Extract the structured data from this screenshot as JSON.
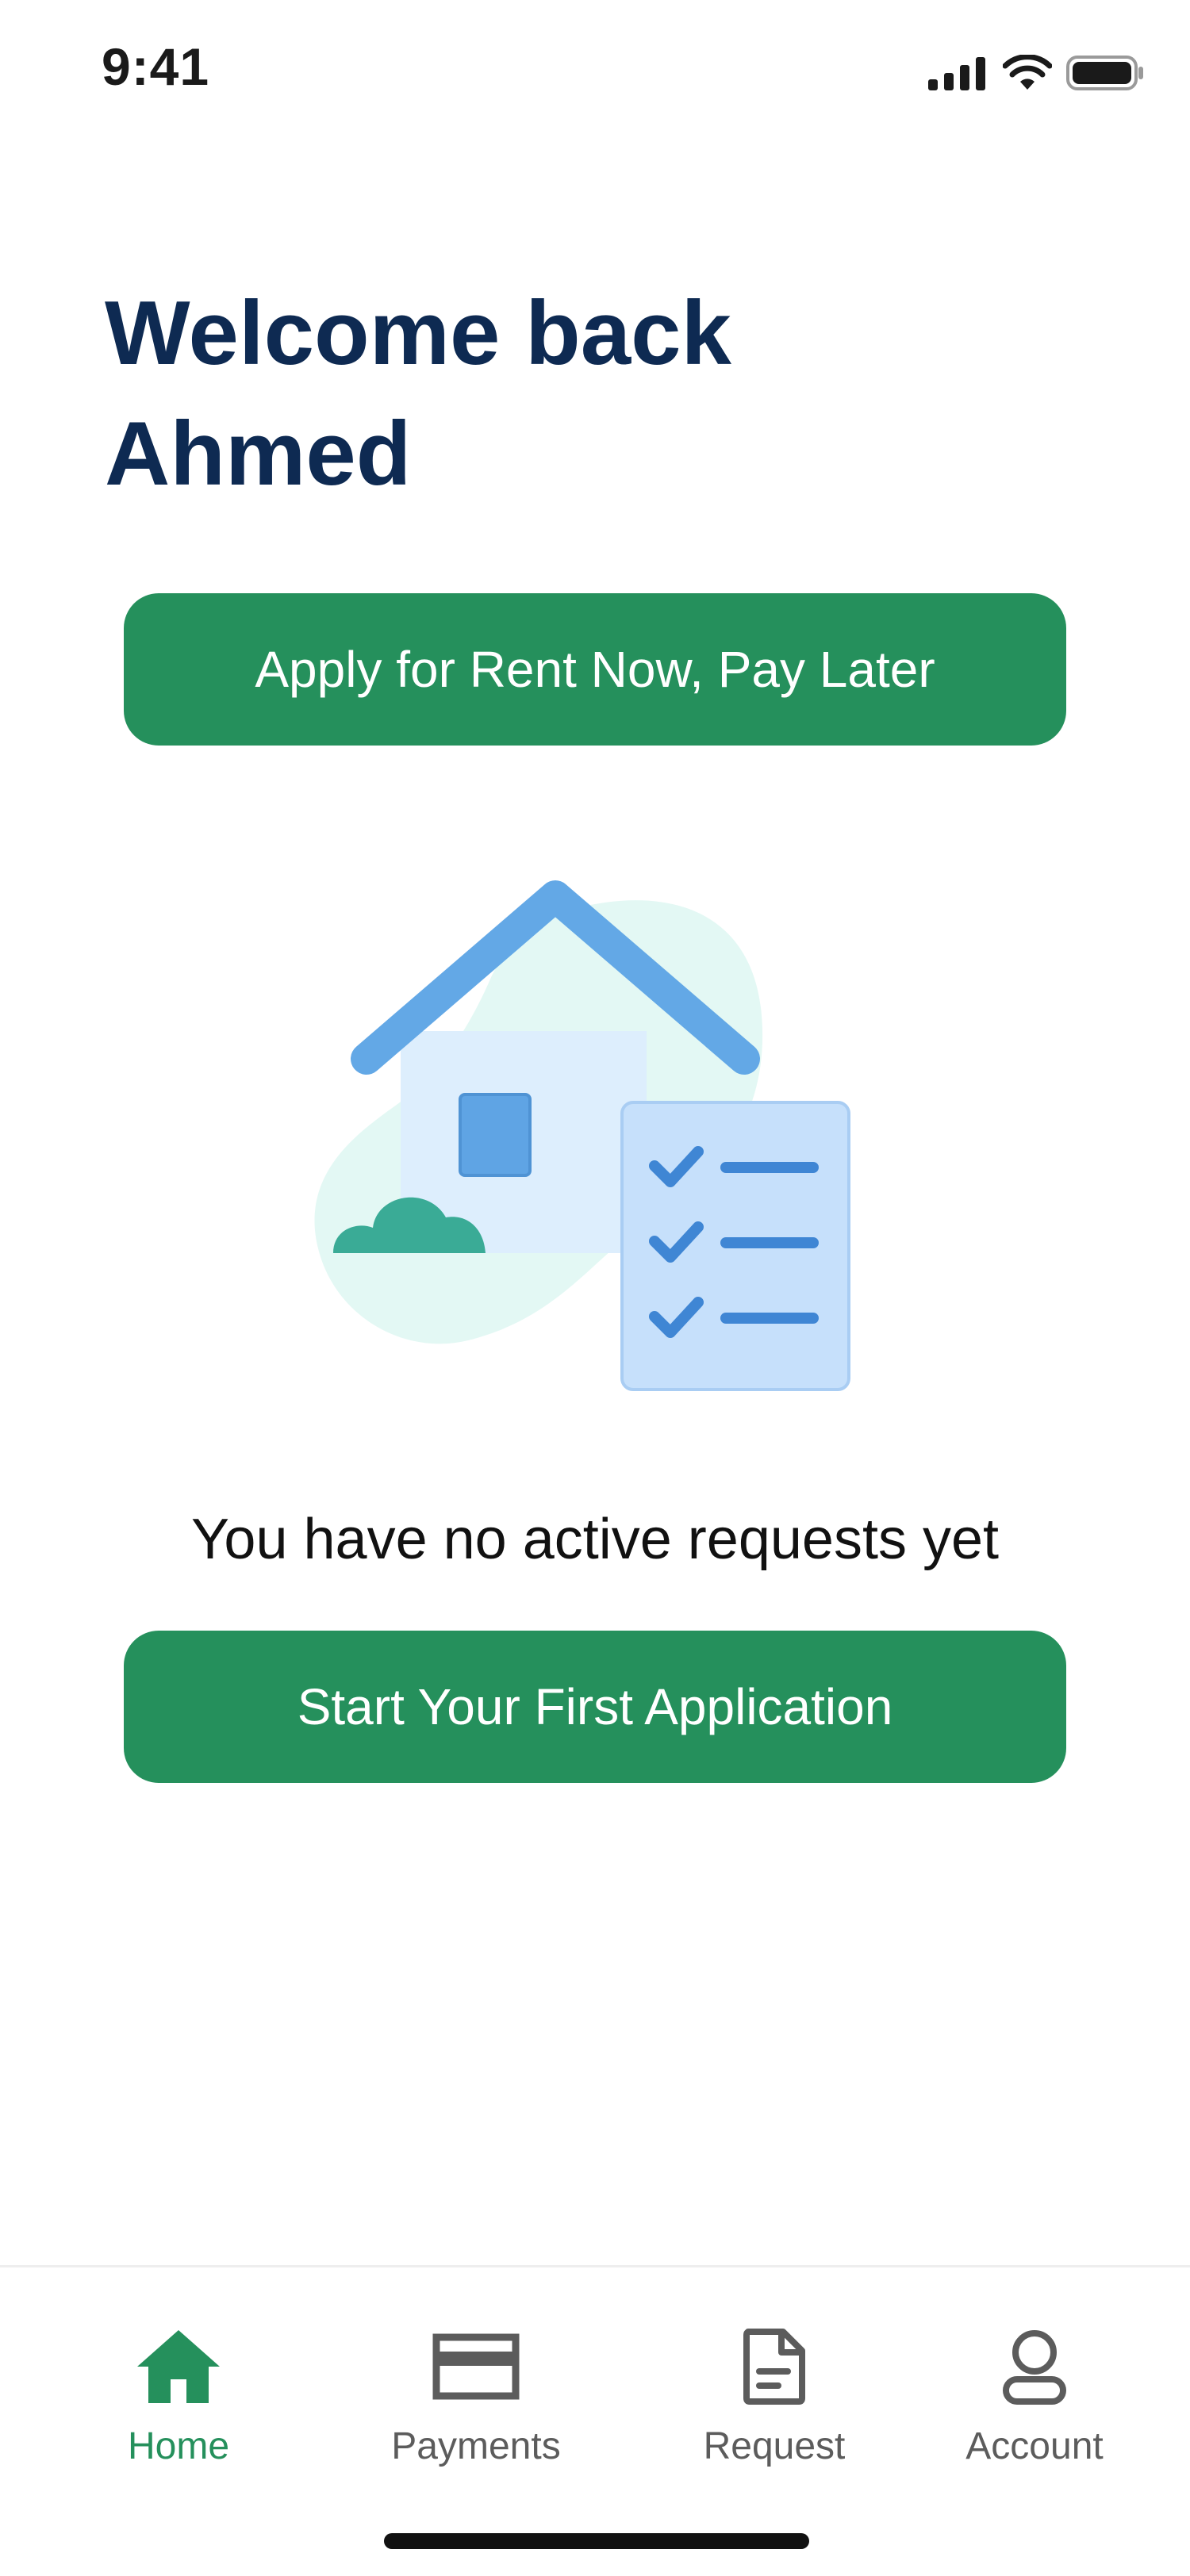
{
  "status_bar": {
    "time": "9:41"
  },
  "greeting": {
    "line1": "Welcome back",
    "line2": "Ahmed"
  },
  "actions": {
    "rnpl_label": "Apply for Rent Now, Pay Later",
    "start_label": "Start Your First Application"
  },
  "empty_state": {
    "message": "You have no active requests yet"
  },
  "bottom_nav": {
    "items": [
      {
        "label": "Home",
        "icon": "home-icon",
        "active": true
      },
      {
        "label": "Payments",
        "icon": "card-icon",
        "active": false
      },
      {
        "label": "Request",
        "icon": "document-icon",
        "active": false
      },
      {
        "label": "Account",
        "icon": "user-icon",
        "active": false
      }
    ]
  },
  "colors": {
    "primary": "#25905c",
    "heading": "#0e2a52",
    "nav_inactive": "#5c5c5c"
  }
}
